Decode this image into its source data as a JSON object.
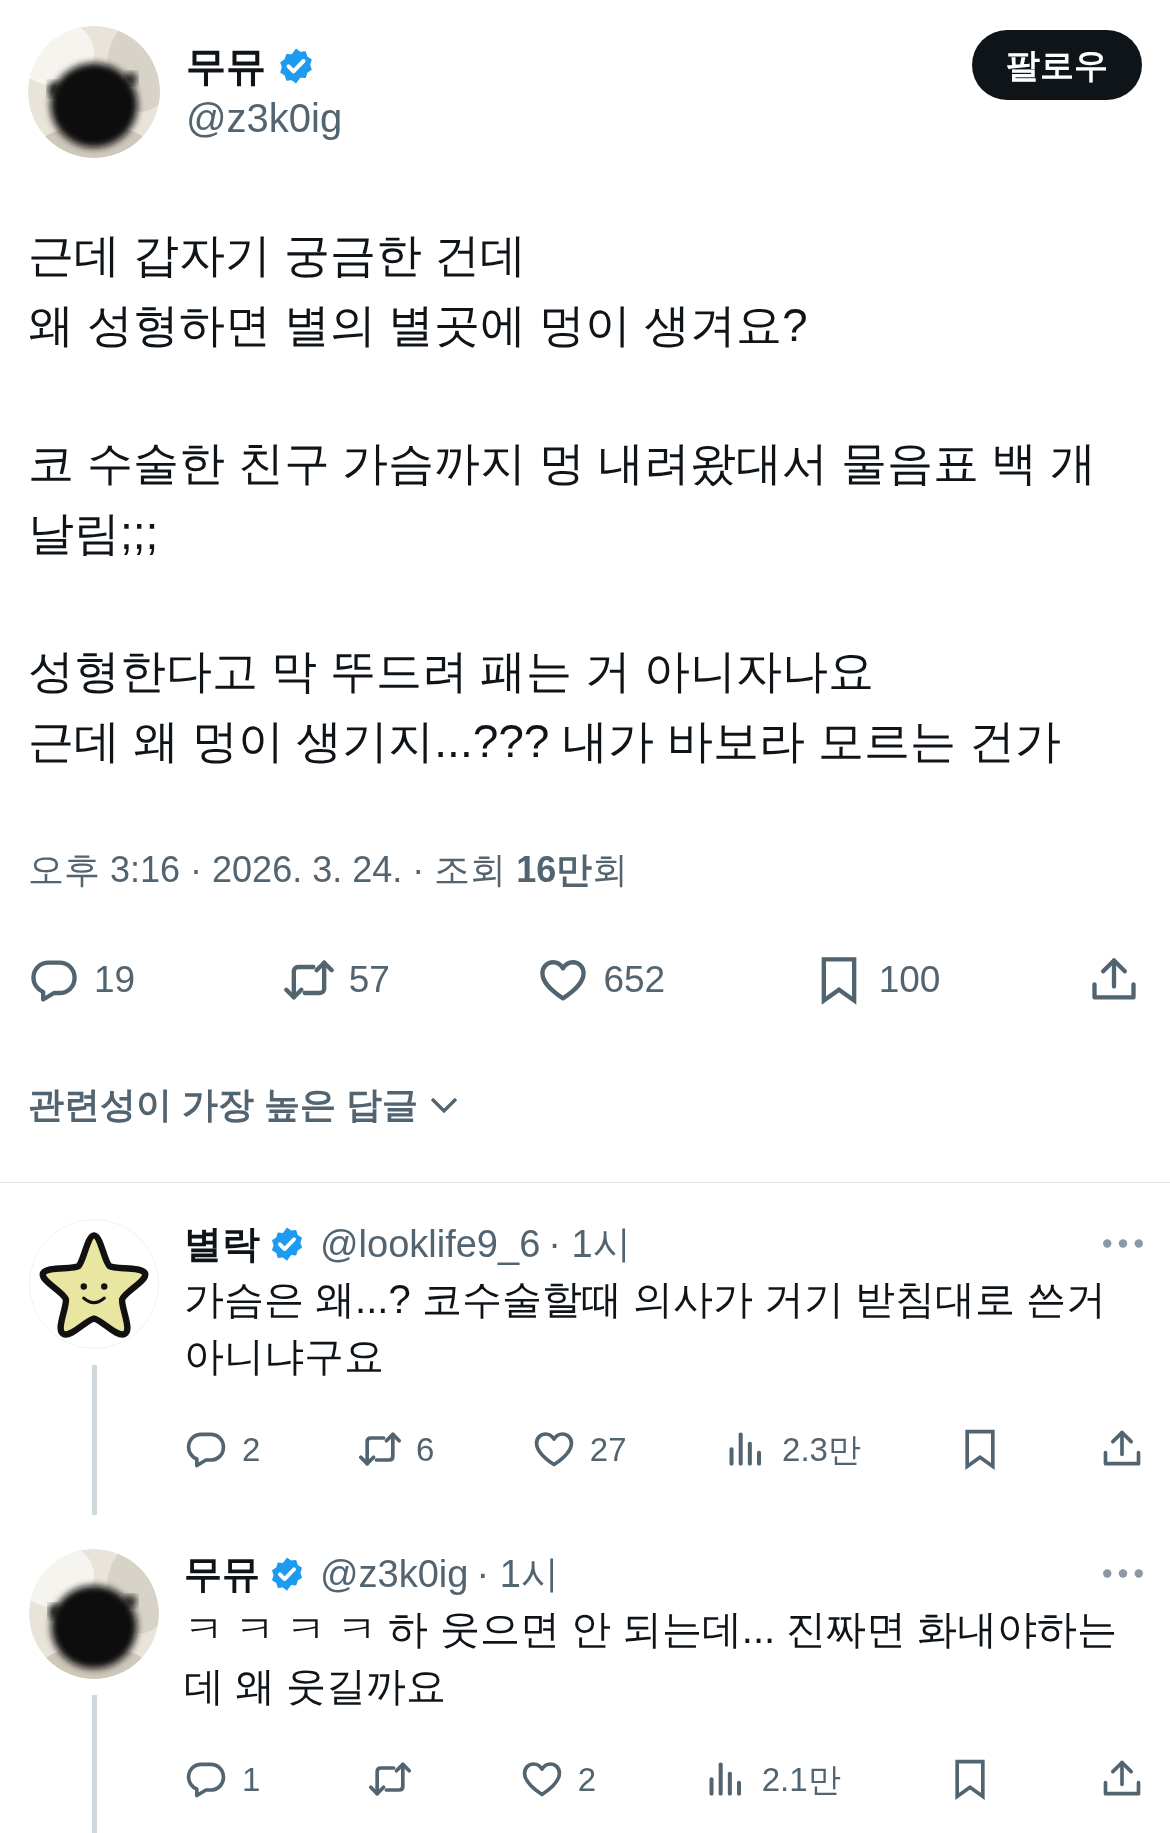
{
  "tweet": {
    "author": {
      "name": "무뮤",
      "verified": true,
      "handle": "@z3k0ig"
    },
    "follow_button": "팔로우",
    "paragraphs": [
      [
        "근데 갑자기 궁금한 건데",
        "왜 성형하면 별의 별곳에 멍이 생겨요?"
      ],
      [
        "코 수술한 친구 가슴까지 멍 내려왔대서 물음표 백 개 날림;;;"
      ],
      [
        "성형한다고 막 뚜드려 패는 거 아니자나요",
        "근데 왜 멍이 생기지...??? 내가 바보라 모르는 건가"
      ]
    ],
    "meta": "오후 3:16 · 2026. 3. 24. · 조회 **16만**회",
    "actions": [
      {
        "kind": "reply",
        "count": "19"
      },
      {
        "kind": "repost",
        "count": "57"
      },
      {
        "kind": "like",
        "count": "652"
      },
      {
        "kind": "bookmark",
        "count": "100"
      },
      {
        "kind": "share"
      }
    ]
  },
  "replies_sort": "관련성이 가장 높은 답글",
  "replies": [
    {
      "author": {
        "name": "별락",
        "verified": true,
        "handle": "@looklife9_6",
        "avatar": {
          "kind": "star"
        }
      },
      "time": "· 1시",
      "text": "가슴은 왜...? 코수술할때 의사가 거기 받침대로 쓴거 아니냐구요",
      "thread_line": true,
      "actions": [
        {
          "kind": "reply",
          "count": "2"
        },
        {
          "kind": "repost",
          "count": "6"
        },
        {
          "kind": "like",
          "count": "27"
        },
        {
          "kind": "views",
          "count": "2.3만"
        },
        {
          "kind": "bookmark"
        },
        {
          "kind": "share"
        }
      ]
    },
    {
      "author": {
        "name": "무뮤",
        "verified": true,
        "handle": "@z3k0ig"
      },
      "time": "· 1시",
      "text": "ㅋ ㅋ ㅋ ㅋ 하 웃으면 안 되는데... 진짜면 화내야하는데 왜 웃길까요",
      "thread_line": true,
      "actions": [
        {
          "kind": "reply",
          "count": "1"
        },
        {
          "kind": "repost"
        },
        {
          "kind": "like",
          "count": "2"
        },
        {
          "kind": "views",
          "count": "2.1만"
        },
        {
          "kind": "bookmark"
        },
        {
          "kind": "share"
        }
      ]
    }
  ]
}
